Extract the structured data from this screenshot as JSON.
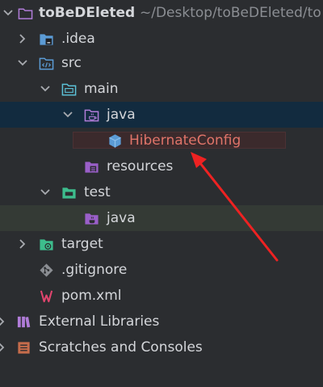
{
  "project": {
    "name": "toBeDEleted",
    "path": "~/Desktop/toBeDEleted/to"
  },
  "tree": {
    "idea": ".idea",
    "src": "src",
    "main": "main",
    "java_main": "java",
    "hibernate_config": "HibernateConfig",
    "resources": "resources",
    "test": "test",
    "java_test": "java",
    "target": "target",
    "gitignore": ".gitignore",
    "pom": "pom.xml",
    "external_libraries": "External Libraries",
    "scratches": "Scratches and Consoles"
  },
  "colors": {
    "folder": "#b07cd8",
    "test_folder": "#3dbd8d",
    "source_folder": "#5b9bd5",
    "selected_row": "#122b3f",
    "error_text": "#e07469",
    "annotation_arrow": "#ee2222"
  }
}
